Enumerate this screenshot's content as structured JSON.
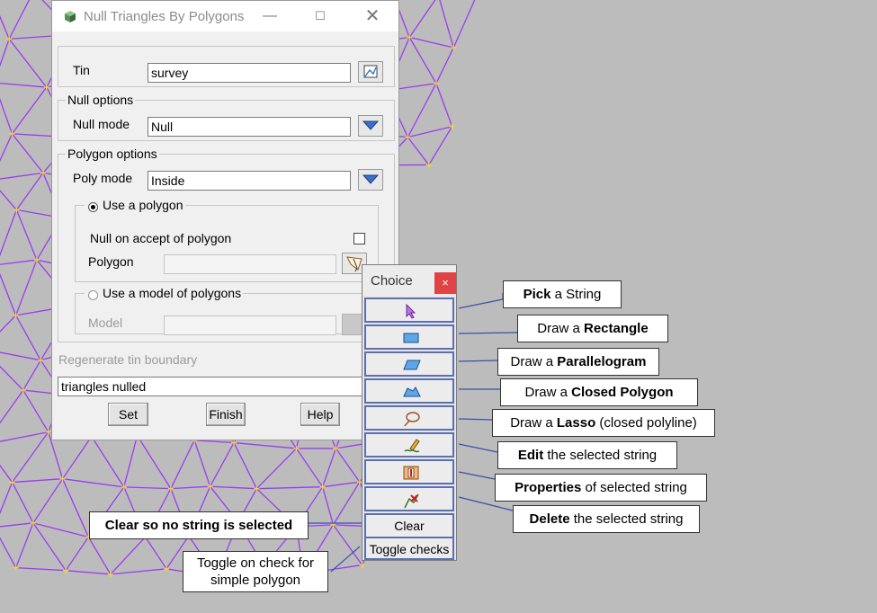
{
  "dialog": {
    "title": "Null Triangles By Polygons",
    "tin_label": "Tin",
    "tin_value": "survey",
    "null_options_label": "Null options",
    "null_mode_label": "Null mode",
    "null_mode_value": "Null",
    "polygon_options_label": "Polygon options",
    "poly_mode_label": "Poly mode",
    "poly_mode_value": "Inside",
    "use_polygon_label": "Use a polygon",
    "null_on_accept_label": "Null on accept of polygon",
    "polygon_label": "Polygon",
    "use_model_label": "Use a model of polygons",
    "model_label": "Model",
    "regen_label": "Regenerate tin boundary",
    "status_text": "triangles nulled",
    "set_label": "Set",
    "finish_label": "Finish",
    "help_label": "Help"
  },
  "choice": {
    "title": "Choice",
    "close": "×",
    "clear_label": "Clear",
    "toggle_label": "Toggle checks"
  },
  "callouts": {
    "pick": {
      "bold": "Pick",
      "rest": " a String"
    },
    "rect": {
      "pre": "Draw a ",
      "bold": "Rectangle"
    },
    "para": {
      "pre": "Draw a ",
      "bold": "Parallelogram"
    },
    "closed": {
      "pre": "Draw a ",
      "bold": "Closed Polygon"
    },
    "lasso": {
      "pre": "Draw a ",
      "bold": "Lasso",
      "rest": " (closed polyline)"
    },
    "edit": {
      "bold": "Edit",
      "rest": " the selected string"
    },
    "props": {
      "bold": "Properties",
      "rest": " of selected string"
    },
    "delete": {
      "bold": "Delete",
      "rest": " the selected string"
    },
    "clear": {
      "bold": "Clear so no string is selected"
    },
    "toggle": {
      "line1": "Toggle on check for",
      "line2": "simple polygon"
    }
  },
  "colors": {
    "tin_lines": "#9b3cf0",
    "tin_vertices": "#f0e020",
    "accent_border": "#5c6fb0",
    "close_red": "#e04343"
  }
}
